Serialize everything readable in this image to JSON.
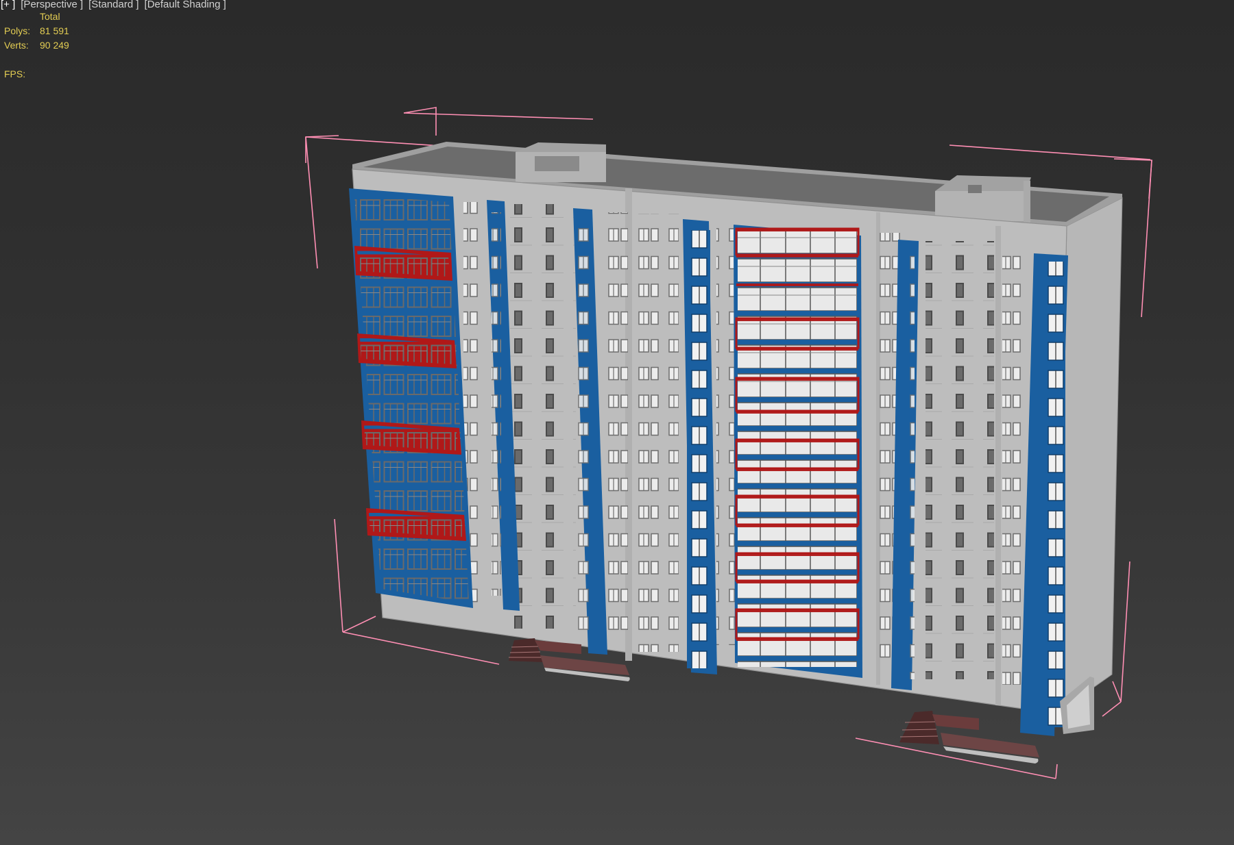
{
  "viewport": {
    "label": {
      "pov": "[+ ]",
      "view": "[Perspective ]",
      "shading_style": "[Standard ]",
      "shading_mode": "[Default Shading ]"
    },
    "stats": {
      "column": "Total",
      "polys_label": "Polys:",
      "polys_value": "81 591",
      "verts_label": "Verts:",
      "verts_value": "90 249",
      "fps_label": "FPS:"
    }
  },
  "scene": {
    "object": "residential-building-model",
    "floors_visible": 15,
    "colors": {
      "background": "#303030",
      "facade": "#bdbdbd",
      "accent_blue": "#1a5fa0",
      "accent_red": "#b01818",
      "bounding_box": "#ff8fb4",
      "stats_text": "#e3cd53"
    }
  }
}
